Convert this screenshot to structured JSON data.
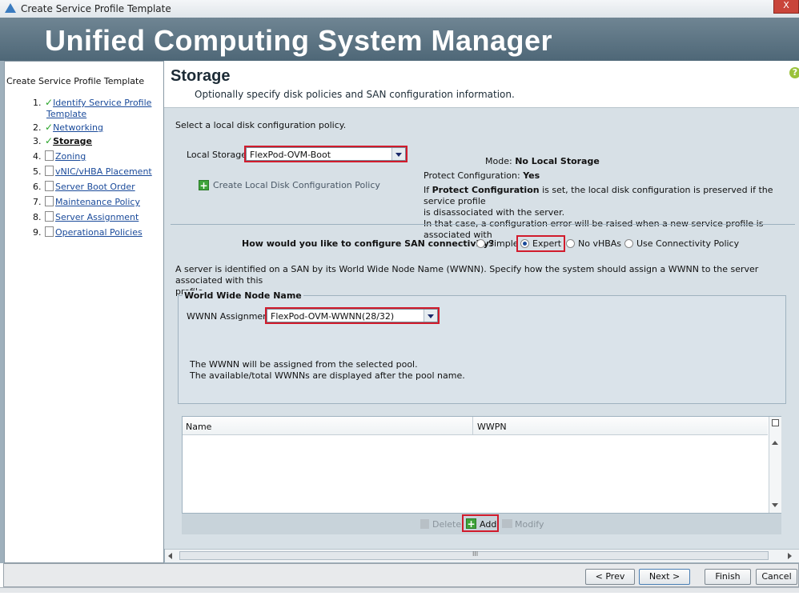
{
  "window": {
    "title": "Create Service Profile Template",
    "close_label": "X"
  },
  "banner": {
    "title": "Unified Computing System Manager"
  },
  "nav": {
    "heading": "Create Service Profile Template",
    "steps": [
      {
        "num": "1.",
        "label": "Identify Service Profile",
        "label2": "Template",
        "status": "done"
      },
      {
        "num": "2.",
        "label": "Networking",
        "status": "done"
      },
      {
        "num": "3.",
        "label": "Storage",
        "status": "current"
      },
      {
        "num": "4.",
        "label": "Zoning",
        "status": "pending"
      },
      {
        "num": "5.",
        "label": "vNIC/vHBA Placement",
        "status": "pending"
      },
      {
        "num": "6.",
        "label": "Server Boot Order",
        "status": "pending"
      },
      {
        "num": "7.",
        "label": "Maintenance Policy",
        "status": "pending"
      },
      {
        "num": "8.",
        "label": "Server Assignment",
        "status": "pending"
      },
      {
        "num": "9.",
        "label": "Operational Policies",
        "status": "pending"
      }
    ]
  },
  "page": {
    "title": "Storage",
    "subtitle": "Optionally specify disk policies and SAN configuration information.",
    "help_icon": "?"
  },
  "local_storage": {
    "intro": "Select a local disk configuration policy.",
    "label": "Local Storage:",
    "value": "FlexPod-OVM-Boot",
    "create_link": "Create Local Disk Configuration Policy",
    "mode_label": "Mode:",
    "mode_value": "No Local Storage",
    "protect_label": "Protect Configuration:",
    "protect_value": "Yes",
    "note_prefix": "If ",
    "note_bold": "Protect Configuration",
    "note_rest": " is set, the local disk configuration is preserved if the service profile",
    "note_line2": "is disassociated with the server.",
    "note_line3": "In that case, a configuration error will be raised when a new service profile is associated with"
  },
  "san": {
    "question": "How would you like to configure SAN connectivity?",
    "options": [
      "Simple",
      "Expert",
      "No vHBAs",
      "Use Connectivity Policy"
    ],
    "selected": "Expert",
    "description_line1": "A server is identified on a SAN by its World Wide Node Name (WWNN). Specify how the system should assign a WWNN to the server associated with this",
    "description_line2": "profile."
  },
  "wwnn": {
    "legend": "World Wide Node Name",
    "label": "WWNN Assignment:",
    "value": "FlexPod-OVM-WWNN(28/32)",
    "note1": "The WWNN will be assigned from the selected pool.",
    "note2": "The available/total WWNNs are displayed after the pool name."
  },
  "table": {
    "columns": [
      "Name",
      "WWPN"
    ],
    "rows": [],
    "actions": {
      "delete": "Delete",
      "add": "Add",
      "modify": "Modify"
    },
    "hscroll_grip": "III"
  },
  "footer": {
    "prev": "< Prev",
    "next": "Next >",
    "finish": "Finish",
    "cancel": "Cancel"
  },
  "colors": {
    "banner": "#5b7282",
    "accent_red": "#d11b2c",
    "link": "#1a4a9a",
    "check": "#2aa52a"
  }
}
